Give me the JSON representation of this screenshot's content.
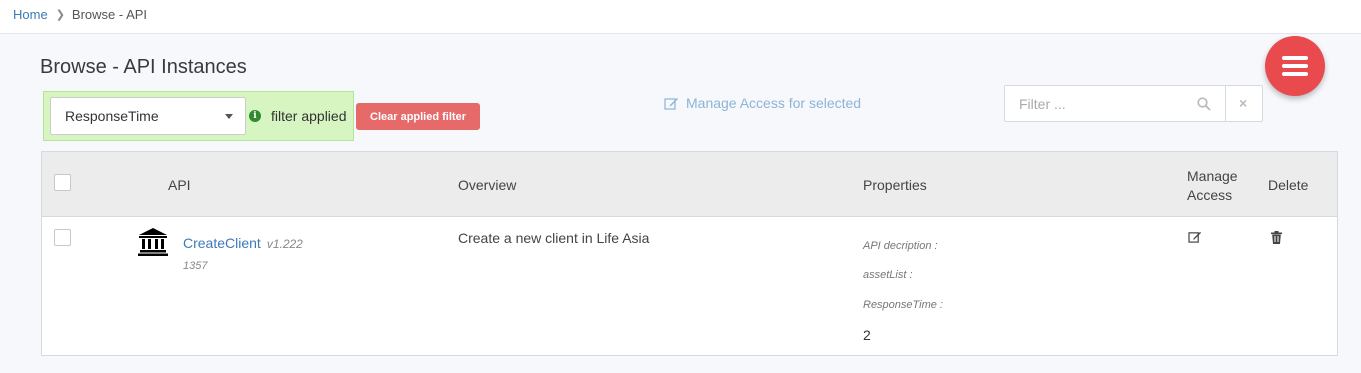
{
  "breadcrumb": {
    "home": "Home",
    "current": "Browse - API"
  },
  "page": {
    "title": "Browse - API Instances"
  },
  "filter": {
    "selected": "ResponseTime",
    "status": "filter applied",
    "clear_label": "Clear applied filter",
    "search_placeholder": "Filter ...",
    "clear_search": "×"
  },
  "actions": {
    "manage_access_selected": "Manage Access for selected"
  },
  "colors": {
    "accent": "#e84a4e",
    "link": "#3d7ab8",
    "filter_bg": "#d6f5c0",
    "clear_btn": "#e66a6a"
  },
  "table": {
    "headers": {
      "api": "API",
      "overview": "Overview",
      "properties": "Properties",
      "manage_access": "Manage Access",
      "delete": "Delete"
    },
    "rows": [
      {
        "icon": "bank-icon",
        "name": "CreateClient",
        "version": "v1.222",
        "id": "1357",
        "overview": "Create a new client in Life Asia",
        "properties": [
          {
            "label": "API decription :",
            "value": ""
          },
          {
            "label": "assetList :",
            "value": ""
          },
          {
            "label": "ResponseTime :",
            "value": "2"
          }
        ]
      }
    ]
  }
}
